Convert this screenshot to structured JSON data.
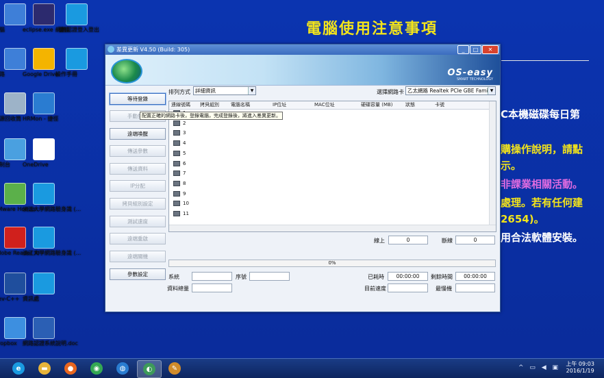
{
  "desktop": {
    "background_text": {
      "title": "電腦使用注意事項",
      "lines": [
        {
          "text": "C本機磁碟每日第",
          "color": "#ffffff"
        },
        {
          "text": "購操作說明，請點",
          "color": "#f3e41a"
        },
        {
          "text": "示。",
          "color": "#f3e41a"
        },
        {
          "text": "非課業相關活動。",
          "color": "#e06be0"
        },
        {
          "text": "處理。若有任何建",
          "color": "#f3e41a"
        },
        {
          "text": "2654)。",
          "color": "#f3e41a"
        },
        {
          "text": "用合法軟體安裝。",
          "color": "#ffffff"
        }
      ]
    },
    "icons": [
      {
        "label": "電腦",
        "icon": "computer-icon",
        "color": "#3e7fd8"
      },
      {
        "label": "eclipse.exe - 捷徑",
        "icon": "eclipse-icon",
        "color": "#2c2a6e"
      },
      {
        "label": "網路認證登入登出",
        "icon": "ie-shortcut-icon",
        "color": "#1a9ae0"
      },
      {
        "label": "網路",
        "icon": "network-icon",
        "color": "#3e7fd8"
      },
      {
        "label": "Google Drive",
        "icon": "google-drive-icon",
        "color": "#f4b400"
      },
      {
        "label": "操作手冊",
        "icon": "ie-shortcut-icon",
        "color": "#1a9ae0"
      },
      {
        "label": "資源回收筒",
        "icon": "recycle-bin-icon",
        "color": "#9db3c8"
      },
      {
        "label": "HRMon - 捷徑",
        "icon": "hrmon-icon",
        "color": "#2a7cd1"
      },
      {
        "label": "控制台",
        "icon": "control-panel-icon",
        "color": "#4aa0e0"
      },
      {
        "label": "OneDrive",
        "icon": "onedrive-icon",
        "color": "#ffffff"
      },
      {
        "label": "VMware Horizo...",
        "icon": "vmware-icon",
        "color": "#5bb04a"
      },
      {
        "label": "淡江大學網路驗身識 (...",
        "icon": "ie-shortcut-icon",
        "color": "#1a9ae0"
      },
      {
        "label": "Adobe Reader XI",
        "icon": "adobe-reader-icon",
        "color": "#d0201c"
      },
      {
        "label": "淡江大學網路驗身識 (...",
        "icon": "ie-shortcut-icon",
        "color": "#1a9ae0"
      },
      {
        "label": "Dev-C++",
        "icon": "devcpp-icon",
        "color": "#1f4e9d"
      },
      {
        "label": "資訊處",
        "icon": "ie-shortcut-icon",
        "color": "#1a9ae0"
      },
      {
        "label": "Dropbox",
        "icon": "dropbox-icon",
        "color": "#3d8fe0"
      },
      {
        "label": "網路認證系統說明.doc",
        "icon": "word-doc-icon",
        "color": "#2b5fb4"
      }
    ]
  },
  "window": {
    "title": "差異更新 V4.50 (Build: 305)",
    "brand": "OS-easy",
    "brand_sub": "SMART TECHNOLOGY",
    "controls": {
      "minimize": "_",
      "maximize": "□",
      "close": "✕"
    },
    "buttons": [
      {
        "label": "等待登錄",
        "state": "active"
      },
      {
        "label": "手動登錄",
        "state": "disabled"
      },
      {
        "label": "遠端喚醒",
        "state": "enabled"
      },
      {
        "label": "傳送參數",
        "state": "disabled"
      },
      {
        "label": "傳送資料",
        "state": "disabled"
      },
      {
        "label": "IP分配",
        "state": "disabled"
      },
      {
        "label": "拷貝組別設定",
        "state": "disabled"
      },
      {
        "label": "測試速度",
        "state": "disabled"
      },
      {
        "label": "遠端重啟",
        "state": "disabled"
      },
      {
        "label": "遠端關機",
        "state": "disabled"
      },
      {
        "label": "參數設定",
        "state": "enabled"
      }
    ],
    "sort": {
      "label": "排列方式",
      "value": "詳細資訊"
    },
    "nic": {
      "label": "選擇網路卡",
      "value": "乙太網路 Realtek PCIe GBE Family Cont"
    },
    "tooltip": "配置正確的網路卡後，登錄電腦，完成登錄後，將進入差異更新。",
    "table": {
      "columns": [
        "連線號碼",
        "拷貝組別",
        "電腦名稱",
        "IP位址",
        "MAC位址",
        "硬碟容量 (MB)",
        "狀態",
        "卡號"
      ],
      "rows": [
        "1",
        "2",
        "3",
        "4",
        "5",
        "6",
        "7",
        "8",
        "9",
        "10",
        "11"
      ]
    },
    "online": {
      "label": "線上",
      "value": "0"
    },
    "offline": {
      "label": "斷線",
      "value": "0"
    },
    "progress": {
      "percent": 0,
      "text": "0%"
    },
    "stats": {
      "system": {
        "label": "系統",
        "value": ""
      },
      "serial": {
        "label": "序號",
        "value": ""
      },
      "elapsed": {
        "label": "已耗時",
        "value": "00:00:00"
      },
      "remaining": {
        "label": "剩餘時間",
        "value": "00:00:00"
      },
      "data_amount": {
        "label": "資料總量",
        "value": ""
      },
      "current_speed": {
        "label": "目前速度",
        "value": ""
      },
      "slowest": {
        "label": "最慢機",
        "value": ""
      }
    }
  },
  "taskbar": {
    "items": [
      {
        "name": "ie",
        "glyph": "e",
        "color": "#1a9ae0"
      },
      {
        "name": "file-explorer",
        "glyph": "▬",
        "color": "#e6b33a"
      },
      {
        "name": "firefox",
        "glyph": "●",
        "color": "#e8661f"
      },
      {
        "name": "chrome",
        "glyph": "◉",
        "color": "#34a853"
      },
      {
        "name": "network-manager",
        "glyph": "◍",
        "color": "#2a7cd1"
      },
      {
        "name": "os-easy-update",
        "glyph": "◐",
        "color": "#3d9a5a"
      },
      {
        "name": "paint-tool",
        "glyph": "✎",
        "color": "#d08b2b"
      }
    ],
    "time": "上午 09:03",
    "date": "2016/1/19",
    "tray": "^ ▭ ◀ ▣"
  }
}
